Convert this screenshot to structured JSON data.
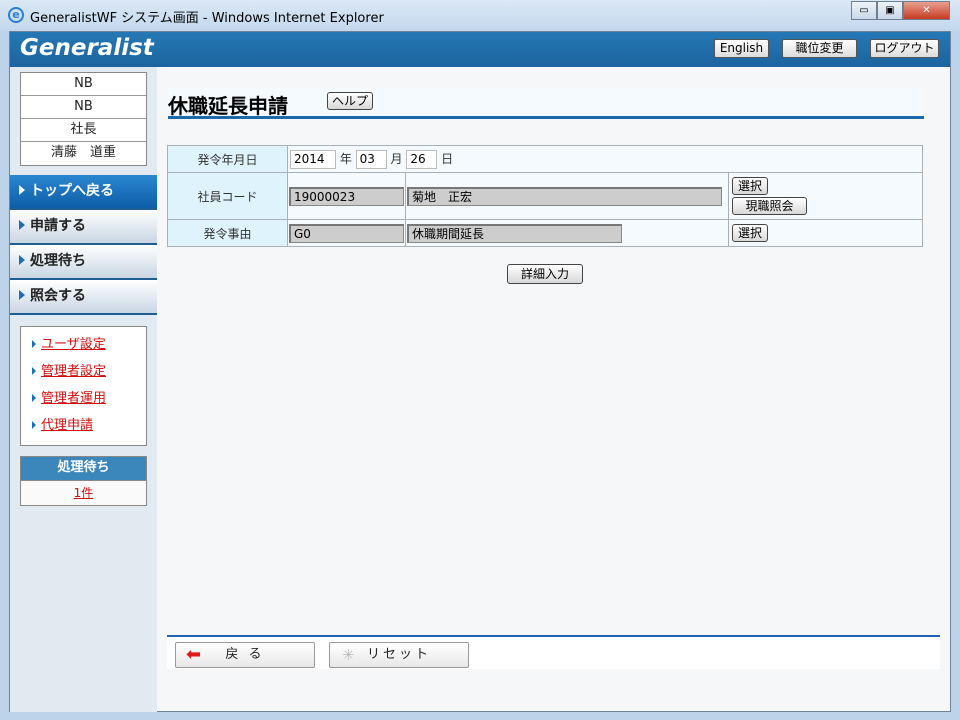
{
  "window": {
    "title": "GeneralistWF システム画面 - Windows Internet Explorer",
    "minimize": "▭",
    "maximize": "▣",
    "close": "✕"
  },
  "header": {
    "logo": "Generalist",
    "english": "English",
    "role_change": "職位変更",
    "logout": "ログアウト"
  },
  "sidebar": {
    "user_info": [
      "NB",
      "NB",
      "社長",
      "清藤　道重"
    ],
    "nav": [
      {
        "label": "トップへ戻る"
      },
      {
        "label": "申請する"
      },
      {
        "label": "処理待ち"
      },
      {
        "label": "照会する"
      }
    ],
    "links": [
      {
        "label": "ユーザ設定"
      },
      {
        "label": "管理者設定"
      },
      {
        "label": "管理者運用"
      },
      {
        "label": "代理申請"
      }
    ],
    "pending": {
      "title": "処理待ち",
      "count": "1件"
    }
  },
  "main": {
    "title": "休職延長申請",
    "help": "ヘルプ",
    "form": {
      "date_label": "発令年月日",
      "year": "2014",
      "year_unit": "年",
      "month": "03",
      "month_unit": "月",
      "day": "26",
      "day_unit": "日",
      "emp_label": "社員コード",
      "emp_code": "19000023",
      "emp_name": "菊地　正宏",
      "select": "選択",
      "current_job": "現職照会",
      "reason_label": "発令事由",
      "reason_code": "G0",
      "reason_name": "休職期間延長"
    },
    "detail": "詳細入力"
  },
  "footer": {
    "back": "戻 る",
    "reset": "リセット"
  }
}
